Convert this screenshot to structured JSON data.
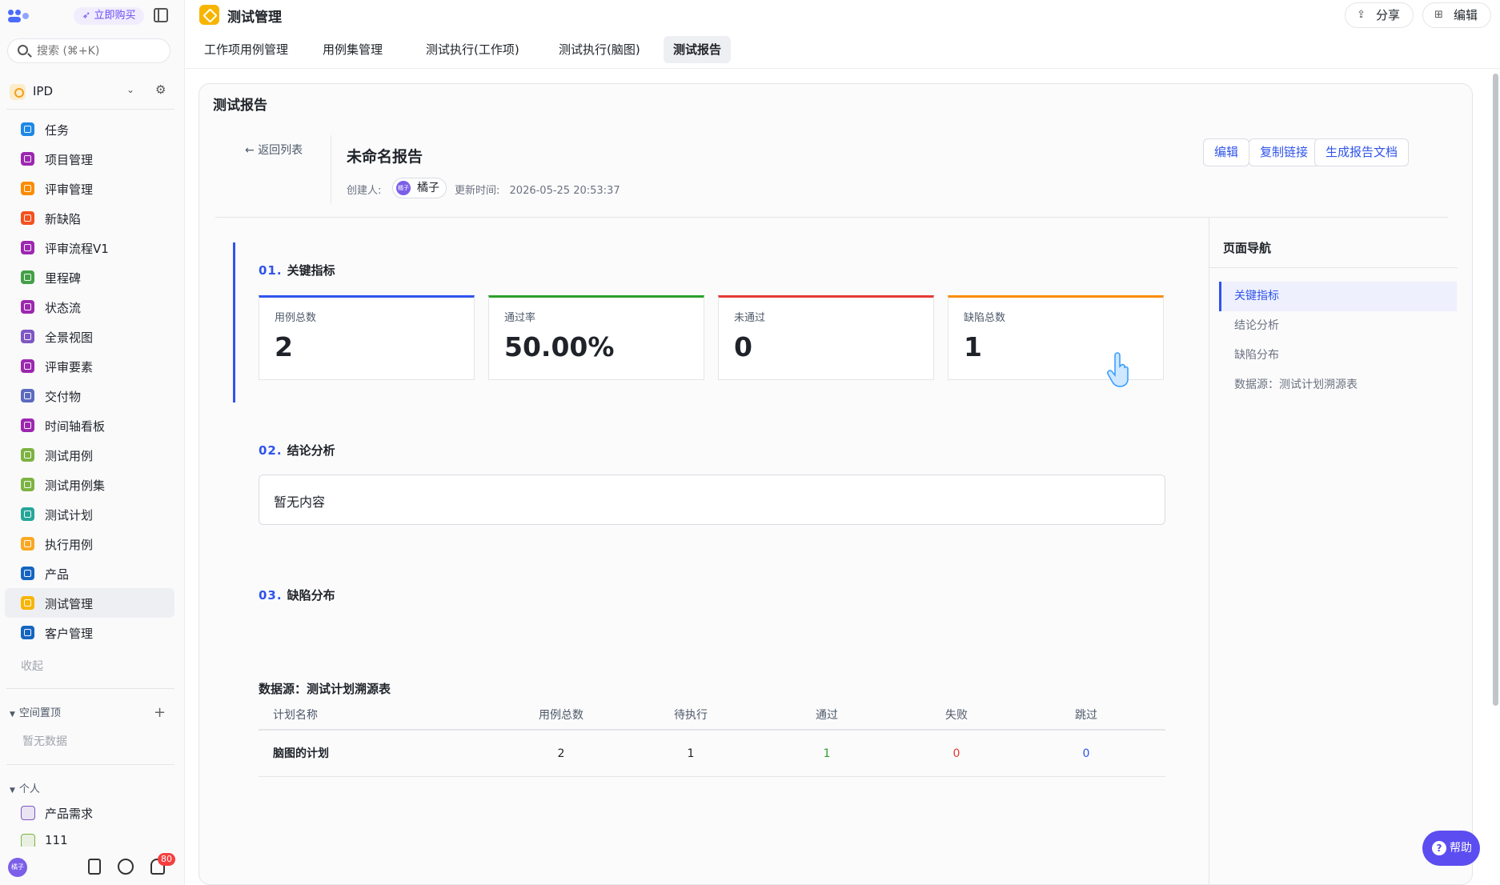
{
  "sidebar": {
    "buy_label": "立即购买",
    "search_placeholder": "搜索 (⌘+K)",
    "workspace_name": "IPD",
    "items": [
      {
        "label": "任务",
        "color": "#1e88e5"
      },
      {
        "label": "项目管理",
        "color": "#9c27b0"
      },
      {
        "label": "评审管理",
        "color": "#fb8c00"
      },
      {
        "label": "新缺陷",
        "color": "#f4511e"
      },
      {
        "label": "评审流程V1",
        "color": "#9c27b0"
      },
      {
        "label": "里程碑",
        "color": "#43a047"
      },
      {
        "label": "状态流",
        "color": "#9c27b0"
      },
      {
        "label": "全景视图",
        "color": "#7e57c2"
      },
      {
        "label": "评审要素",
        "color": "#9c27b0"
      },
      {
        "label": "交付物",
        "color": "#5c6bc0"
      },
      {
        "label": "时间轴看板",
        "color": "#9c27b0"
      },
      {
        "label": "测试用例",
        "color": "#7cb342"
      },
      {
        "label": "测试用例集",
        "color": "#7cb342"
      },
      {
        "label": "测试计划",
        "color": "#26a69a"
      },
      {
        "label": "执行用例",
        "color": "#f9a825"
      },
      {
        "label": "产品",
        "color": "#1565c0"
      },
      {
        "label": "测试管理",
        "color": "#f7b500",
        "active": true
      },
      {
        "label": "客户管理",
        "color": "#1565c0"
      }
    ],
    "collapse_label": "收起",
    "pinned_title": "空间置顶",
    "pinned_empty": "暂无数据",
    "personal_title": "个人",
    "personal_items": [
      {
        "label": "产品需求",
        "color": "#7e57c2"
      },
      {
        "label": "111",
        "color": "#7cb342"
      }
    ],
    "avatar_text": "橘子",
    "notification_count": "80"
  },
  "header": {
    "app_title": "测试管理",
    "share_label": "分享",
    "edit_label": "编辑",
    "tabs": [
      "工作项用例管理",
      "用例集管理",
      "测试执行(工作项)",
      "测试执行(脑图)",
      "测试报告"
    ],
    "active_tab": 4
  },
  "report": {
    "page_title": "测试报告",
    "back_label": "返回列表",
    "name": "未命名报告",
    "creator_label": "创建人:",
    "creator_name": "橘子",
    "creator_avatar_text": "橘子",
    "updated_label": "更新时间:",
    "updated_time": "2026-05-25 20:53:37",
    "actions": {
      "edit": "编辑",
      "copy_link": "复制链接",
      "generate_doc": "生成报告文档"
    },
    "sections": {
      "s1_num": "01.",
      "s1_title": "关键指标",
      "s2_num": "02.",
      "s2_title": "结论分析",
      "s3_num": "03.",
      "s3_title": "缺陷分布"
    },
    "kpis": [
      {
        "label": "用例总数",
        "value": "2",
        "color": "#2f54eb"
      },
      {
        "label": "通过率",
        "value": "50.00%",
        "color": "#2ca02c"
      },
      {
        "label": "未通过",
        "value": "0",
        "color": "#e53935"
      },
      {
        "label": "缺陷总数",
        "value": "1",
        "color": "#fb8c00"
      }
    ],
    "conclusion_text": "暂无内容",
    "datasource_title": "数据源：测试计划溯源表",
    "table": {
      "headers": [
        "计划名称",
        "用例总数",
        "待执行",
        "通过",
        "失败",
        "跳过"
      ],
      "rows": [
        {
          "name": "脑图的计划",
          "total": "2",
          "pending": "1",
          "pass": "1",
          "fail": "0",
          "skip": "0"
        }
      ],
      "pass_color": "#2ca02c",
      "fail_color": "#e53935",
      "skip_color": "#2f54eb"
    }
  },
  "page_nav": {
    "title": "页面导航",
    "items": [
      "关键指标",
      "结论分析",
      "缺陷分布",
      "数据源：测试计划溯源表"
    ],
    "active": 0
  },
  "help_label": "帮助"
}
